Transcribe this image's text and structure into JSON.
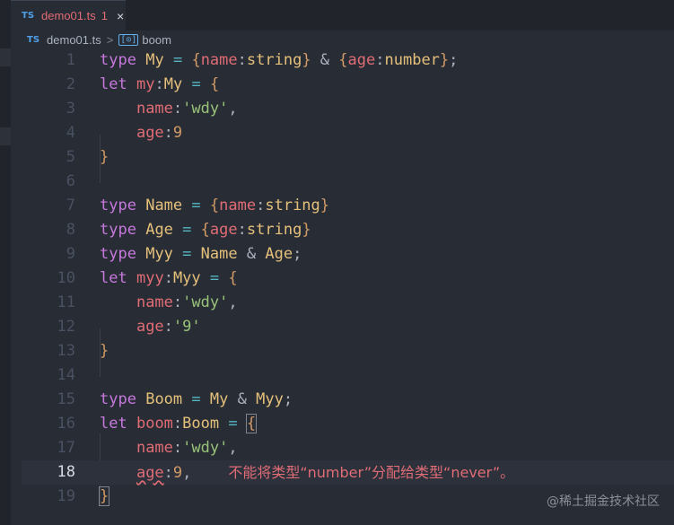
{
  "tab": {
    "lang": "TS",
    "filename": "demo01.ts",
    "problems": "1",
    "close_icon": "×"
  },
  "breadcrumb": {
    "lang": "TS",
    "file": "demo01.ts",
    "sep": ">",
    "symbol_icon": "[⊙]",
    "symbol": "boom"
  },
  "lines": [
    {
      "n": "1"
    },
    {
      "n": "2"
    },
    {
      "n": "3"
    },
    {
      "n": "4"
    },
    {
      "n": "5"
    },
    {
      "n": "6"
    },
    {
      "n": "7"
    },
    {
      "n": "8"
    },
    {
      "n": "9"
    },
    {
      "n": "10"
    },
    {
      "n": "11"
    },
    {
      "n": "12"
    },
    {
      "n": "13"
    },
    {
      "n": "14"
    },
    {
      "n": "15"
    },
    {
      "n": "16"
    },
    {
      "n": "17"
    },
    {
      "n": "18"
    },
    {
      "n": "19"
    }
  ],
  "error_message": "不能将类型“number”分配给类型“never”。",
  "watermark": "@稀土掘金技术社区",
  "colors": {
    "keyword": "#c678dd",
    "type": "#e5c07b",
    "property": "#e06c75",
    "string": "#98c379",
    "number": "#d19a66",
    "error": "#e06c75"
  }
}
